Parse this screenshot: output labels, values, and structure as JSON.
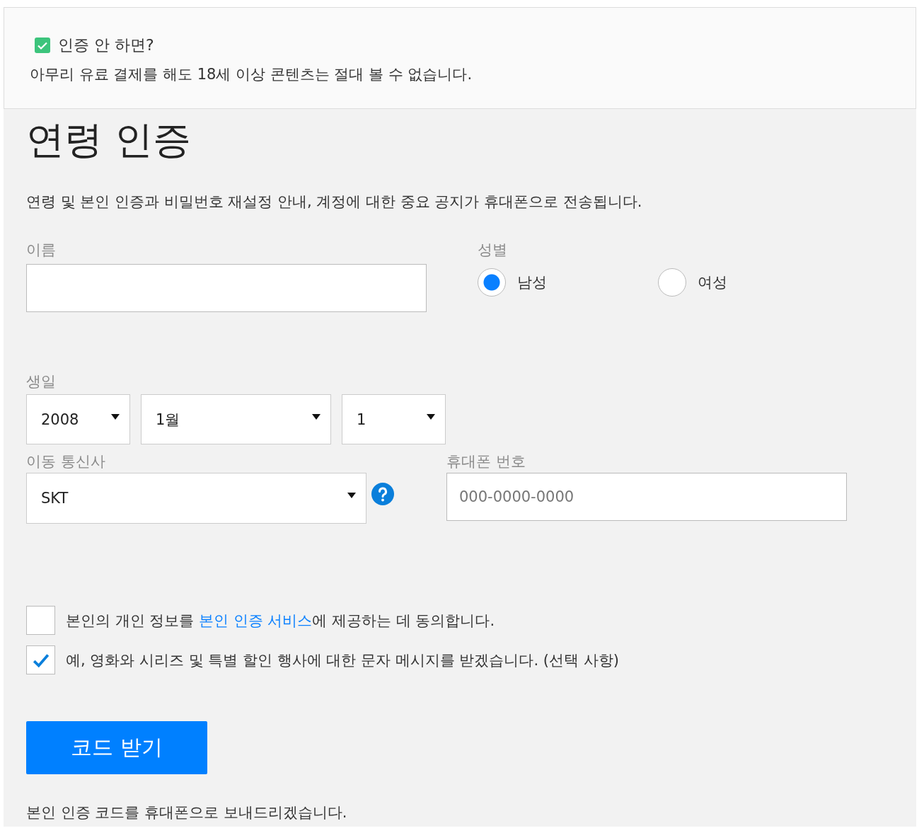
{
  "notice": {
    "checked": true,
    "title": "인증 안 하면?",
    "text": "아무리 유료 결제를 해도 18세 이상 콘텐츠는 절대 볼 수 없습니다."
  },
  "heading": "연령 인증",
  "description": "연령 및 본인 인증과 비밀번호 재설정 안내, 계정에 대한 중요 공지가 휴대폰으로 전송됩니다.",
  "name_field": {
    "label": "이름"
  },
  "gender": {
    "label": "성별",
    "options": [
      {
        "label": "남성",
        "selected": true
      },
      {
        "label": "여성",
        "selected": false
      }
    ]
  },
  "birthday": {
    "label": "생일",
    "selects": [
      {
        "value": "2008"
      },
      {
        "value": "1월"
      },
      {
        "value": "1"
      }
    ]
  },
  "carrier": {
    "label": "이동 통신사",
    "value": "SKT"
  },
  "phone": {
    "label": "휴대폰 번호",
    "placeholder": "000-0000-0000"
  },
  "consents": [
    {
      "checked": false,
      "text_before": "본인의 개인 정보를 ",
      "link": "본인 인증 서비스",
      "text_after": "에 제공하는 데 동의합니다."
    },
    {
      "checked": true,
      "text_before": "예, 영화와 시리즈 및 특별 할인 행사에 대한 문자 메시지를 받겠습니다. (선택 사항)"
    }
  ],
  "submit_button": "코드 받기",
  "footer_text": "본인 인증 코드를 휴대폰으로 보내드리겠습니다."
}
